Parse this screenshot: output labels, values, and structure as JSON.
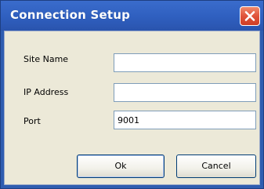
{
  "window": {
    "title": "Connection Setup"
  },
  "form": {
    "site_name": {
      "label": "Site Name",
      "value": ""
    },
    "ip_address": {
      "label": "IP Address",
      "value": ""
    },
    "port": {
      "label": "Port",
      "value": "9001"
    }
  },
  "buttons": {
    "ok_label": "Ok",
    "cancel_label": "Cancel"
  },
  "icons": {
    "close": "close-icon"
  },
  "colors": {
    "titlebar": "#2f5fbf",
    "close_button": "#e0533a",
    "dialog_background": "#ece9d8"
  }
}
